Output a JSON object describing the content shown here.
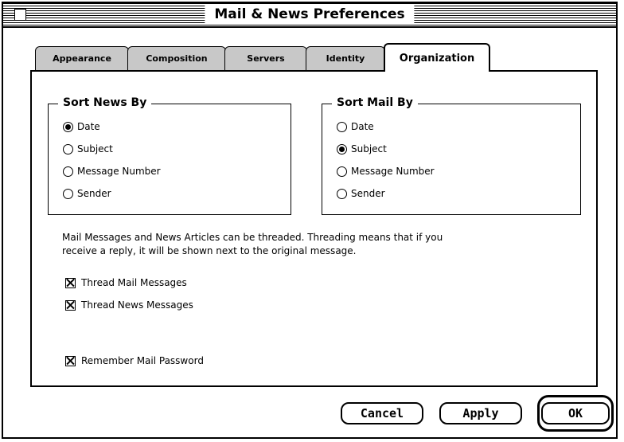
{
  "window": {
    "title": "Mail & News Preferences"
  },
  "tabs": [
    {
      "label": "Appearance"
    },
    {
      "label": "Composition"
    },
    {
      "label": "Servers"
    },
    {
      "label": "Identity"
    },
    {
      "label": "Organization",
      "active": true
    }
  ],
  "sort_news": {
    "title": "Sort News By",
    "options": [
      {
        "label": "Date",
        "checked": true
      },
      {
        "label": "Subject",
        "checked": false
      },
      {
        "label": "Message Number",
        "checked": false
      },
      {
        "label": "Sender",
        "checked": false
      }
    ]
  },
  "sort_mail": {
    "title": "Sort Mail By",
    "options": [
      {
        "label": "Date",
        "checked": false
      },
      {
        "label": "Subject",
        "checked": true
      },
      {
        "label": "Message Number",
        "checked": false
      },
      {
        "label": "Sender",
        "checked": false
      }
    ]
  },
  "threading": {
    "description": "Mail Messages and News Articles can be threaded. Threading means that if you receive a reply, it will be shown next to the original message.",
    "thread_mail": {
      "label": "Thread Mail Messages",
      "checked": true
    },
    "thread_news": {
      "label": "Thread News Messages",
      "checked": true
    }
  },
  "remember_password": {
    "label": "Remember Mail Password",
    "checked": true
  },
  "buttons": {
    "cancel": "Cancel",
    "apply": "Apply",
    "ok": "OK"
  }
}
